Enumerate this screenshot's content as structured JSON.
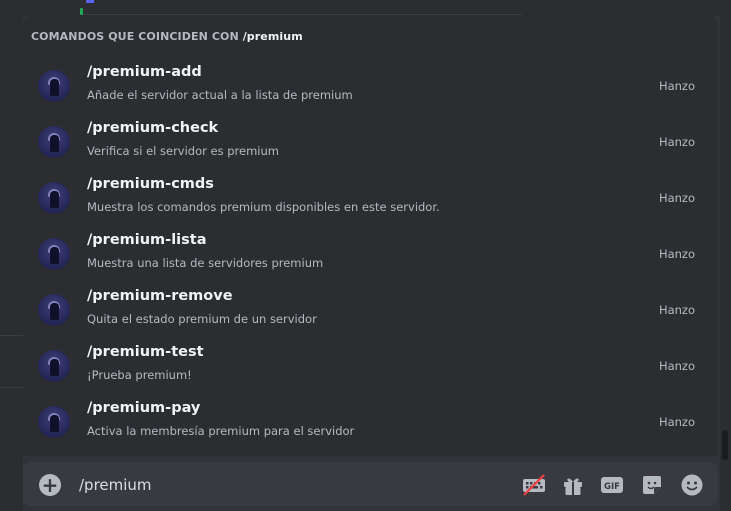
{
  "autocomplete": {
    "header_prefix": "COMANDOS QUE COINCIDEN CON",
    "header_query": "/premium",
    "commands": [
      {
        "name": "/premium-add",
        "description": "Añade el servidor actual a la lista de premium",
        "author": "Hanzo"
      },
      {
        "name": "/premium-check",
        "description": "Verifica si el servidor es premium",
        "author": "Hanzo"
      },
      {
        "name": "/premium-cmds",
        "description": "Muestra los comandos premium disponibles en este servidor.",
        "author": "Hanzo"
      },
      {
        "name": "/premium-lista",
        "description": "Muestra una lista de servidores premium",
        "author": "Hanzo"
      },
      {
        "name": "/premium-remove",
        "description": "Quita el estado premium de un servidor",
        "author": "Hanzo"
      },
      {
        "name": "/premium-test",
        "description": "¡Prueba premium!",
        "author": "Hanzo"
      },
      {
        "name": "/premium-pay",
        "description": "Activa la membresía premium para el servidor",
        "author": "Hanzo"
      }
    ]
  },
  "input": {
    "value": "/premium",
    "add_icon": "plus-circle-icon",
    "tools": [
      "keyboard-disabled-icon",
      "gift-icon",
      "gif-icon",
      "sticker-icon",
      "emoji-icon"
    ],
    "gif_label": "GIF"
  },
  "colors": {
    "background": "#313338",
    "panel": "#2b2d31",
    "input": "#383a40",
    "text_primary": "#f2f3f5",
    "text_secondary": "#b5bac1",
    "disabled_slash": "#ed4245"
  }
}
